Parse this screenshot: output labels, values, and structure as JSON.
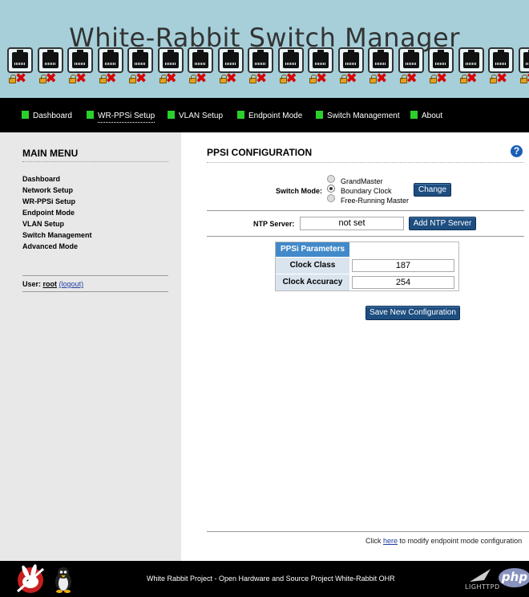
{
  "header": {
    "title": "White-Rabbit Switch Manager",
    "port_count": 18,
    "port_status": "unlocked-disconnected"
  },
  "nav": {
    "items": [
      {
        "label": "Dashboard",
        "icon": "green-square-icon"
      },
      {
        "label": "WR-PPSi Setup",
        "icon": "green-square-icon",
        "active": true
      },
      {
        "label": "VLAN Setup",
        "icon": "green-square-icon"
      },
      {
        "label": "Endpoint Mode",
        "icon": "green-square-icon"
      },
      {
        "label": "Switch Management",
        "icon": "green-square-icon"
      },
      {
        "label": "About",
        "icon": "green-square-icon"
      }
    ]
  },
  "sidebar": {
    "title": "MAIN MENU",
    "items": [
      {
        "label": "Dashboard"
      },
      {
        "label": "Network Setup"
      },
      {
        "label": "WR-PPSi Setup"
      },
      {
        "label": "Endpoint Mode"
      },
      {
        "label": "VLAN Setup"
      },
      {
        "label": "Switch Management"
      },
      {
        "label": "Advanced Mode"
      }
    ],
    "user_prefix": "User:",
    "user_name": "root",
    "logout_label": "(logout)"
  },
  "main": {
    "title": "PPSI CONFIGURATION",
    "help_icon": "question-mark-icon",
    "help_glyph": "?",
    "switch_mode": {
      "label": "Switch Mode:",
      "options": [
        {
          "label": "GrandMaster",
          "selected": false
        },
        {
          "label": "Boundary Clock",
          "selected": true
        },
        {
          "label": "Free-Running Master",
          "selected": false
        }
      ],
      "change_label": "Change"
    },
    "ntp": {
      "label": "NTP Server:",
      "value": "not set",
      "button_label": "Add NTP Server"
    },
    "ppsi_params": {
      "header": "PPSi Parameters",
      "rows": [
        {
          "label": "Clock Class",
          "value": "187"
        },
        {
          "label": "Clock Accuracy",
          "value": "254"
        }
      ]
    },
    "save_label": "Save New Configuration",
    "footnote": {
      "prefix": "Click",
      "link": "here",
      "suffix": "to modify endpoint mode configuration"
    }
  },
  "footer": {
    "text": "White Rabbit Project - Open Hardware and Source Project White-Rabbit OHR",
    "lighttpd_label": "LIGHTTPD",
    "php_label": "php"
  },
  "colors": {
    "header_bg": "#a6cfd9",
    "nav_bg": "#000000",
    "nav_marker": "#2bd02b",
    "sidebar_bg": "#e8e8e8",
    "button": "#1e4e80",
    "table_header": "#4189c9",
    "status_x": "#d80000"
  }
}
